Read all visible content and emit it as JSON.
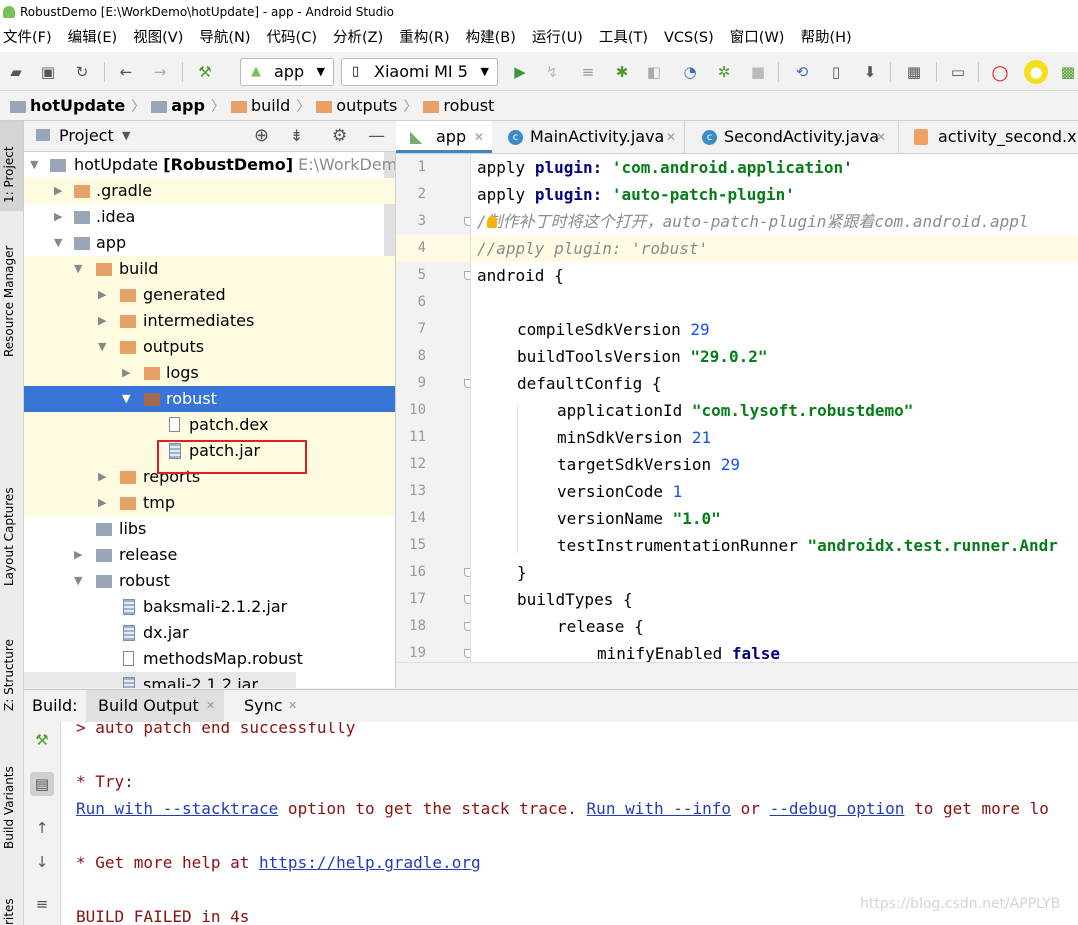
{
  "window": {
    "title": "RobustDemo [E:\\WorkDemo\\hotUpdate] - app - Android Studio"
  },
  "menu": [
    "文件(F)",
    "编辑(E)",
    "视图(V)",
    "导航(N)",
    "代码(C)",
    "分析(Z)",
    "重构(R)",
    "构建(B)",
    "运行(U)",
    "工具(T)",
    "VCS(S)",
    "窗口(W)",
    "帮助(H)"
  ],
  "toolbar": {
    "run_config": "app",
    "device": "Xiaomi MI 5"
  },
  "breadcrumb": [
    "hotUpdate",
    "app",
    "build",
    "outputs",
    "robust"
  ],
  "project_panel": {
    "title": "Project",
    "root_name": "hotUpdate",
    "root_module": "[RobustDemo]",
    "root_path": "E:\\WorkDemo",
    "items": [
      ".gradle",
      ".idea",
      "app",
      "build",
      "generated",
      "intermediates",
      "outputs",
      "logs",
      "robust",
      "patch.dex",
      "patch.jar",
      "reports",
      "tmp",
      "libs",
      "release",
      "robust",
      "baksmali-2.1.2.jar",
      "dx.jar",
      "methodsMap.robust",
      "smali-2.1.2.jar"
    ]
  },
  "editor": {
    "tabs": [
      "app",
      "MainActivity.java",
      "SecondActivity.java",
      "activity_second.xml"
    ],
    "line_numbers": [
      "1",
      "2",
      "3",
      "4",
      "5",
      "6",
      "7",
      "8",
      "9",
      "10",
      "11",
      "12",
      "13",
      "14",
      "15",
      "16",
      "17",
      "18",
      "19"
    ],
    "code": {
      "l1_kw": "apply",
      "l1_key": "plugin:",
      "l1_val": "'com.android.application'",
      "l2_kw": "apply",
      "l2_key": "plugin:",
      "l2_val": "'auto-patch-plugin'",
      "l3": "/制作补丁时将这个打开，auto-patch-plugin紧跟着com.android.appl",
      "l4": "//apply plugin: 'robust'",
      "l5": "android {",
      "l7_a": "compileSdkVersion",
      "l7_b": "29",
      "l8_a": "buildToolsVersion",
      "l8_b": "\"29.0.2\"",
      "l9": "defaultConfig {",
      "l10_a": "applicationId",
      "l10_b": "\"com.lysoft.robustdemo\"",
      "l11_a": "minSdkVersion",
      "l11_b": "21",
      "l12_a": "targetSdkVersion",
      "l12_b": "29",
      "l13_a": "versionCode",
      "l13_b": "1",
      "l14_a": "versionName",
      "l14_b": "\"1.0\"",
      "l15_a": "testInstrumentationRunner",
      "l15_b": "\"androidx.test.runner.Andr",
      "l16": "}",
      "l17": "buildTypes {",
      "l18": "release {",
      "l19_a": "minifyEnabled",
      "l19_b": "false"
    }
  },
  "build_panel": {
    "label": "Build:",
    "tabs": [
      "Build Output",
      "Sync"
    ],
    "lines": {
      "l1": "> auto patch end successfully",
      "l2": "* Try:",
      "l3_link1": "Run with --stacktrace",
      "l3_t1": " option to get the stack trace. ",
      "l3_link2": "Run with --info",
      "l3_t2": " or ",
      "l3_link3": "--debug option",
      "l3_t3": " to get more lo",
      "l4_t": "* Get more help at ",
      "l4_link": "https://help.gradle.org",
      "l5": "BUILD FAILED in 4s"
    }
  },
  "side_tabs": [
    "1: Project",
    "Resource Manager",
    "Layout Captures",
    "Z: Structure",
    "Build Variants",
    "rites"
  ],
  "watermark": "https://blog.csdn.net/APPLYB"
}
